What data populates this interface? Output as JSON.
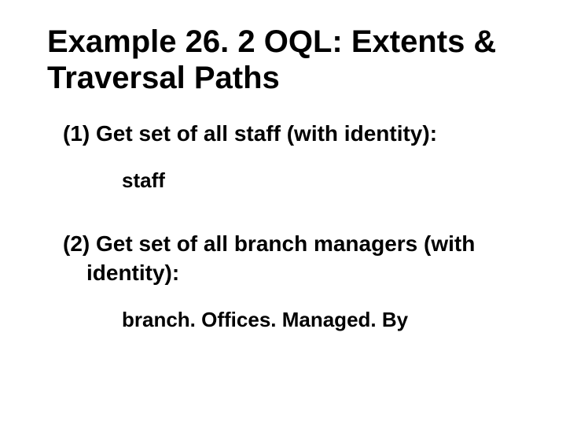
{
  "title": "Example 26. 2 OQL: Extents & Traversal Paths",
  "items": [
    {
      "prompt": "(1) Get set of all staff (with identity):",
      "code": "staff"
    },
    {
      "prompt": "(2) Get set of all branch managers (with identity):",
      "code": "branch. Offices. Managed. By"
    }
  ]
}
